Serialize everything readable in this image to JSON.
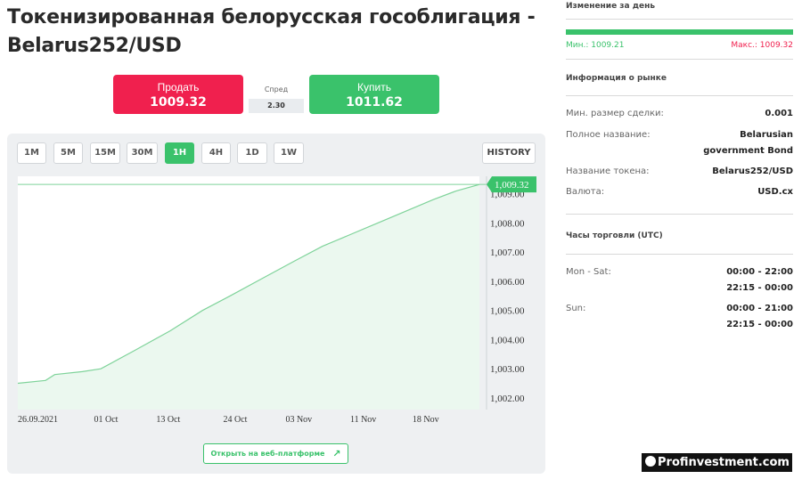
{
  "title": "Токенизированная белорусская гособлигация - Belarus252/USD",
  "trade": {
    "sell_label": "Продать",
    "sell_price": "1009.32",
    "spread_label": "Спред",
    "spread_value": "2.30",
    "buy_label": "Купить",
    "buy_price": "1011.62"
  },
  "timeframes": [
    "1M",
    "5M",
    "15M",
    "30M",
    "1H",
    "4H",
    "1D",
    "1W"
  ],
  "active_timeframe": "1H",
  "history_label": "HISTORY",
  "chart_data": {
    "type": "area",
    "current_price_label": "1,009.32",
    "y_ticks": [
      "1,009.00",
      "1,008.00",
      "1,007.00",
      "1,006.00",
      "1,005.00",
      "1,004.00",
      "1,003.00",
      "1,002.00"
    ],
    "x_ticks": [
      "26.09.2021",
      "01 Oct",
      "13 Oct",
      "24 Oct",
      "03 Nov",
      "11 Nov",
      "18 Nov"
    ],
    "ylim": [
      1001.6,
      1009.6
    ],
    "x": [
      0,
      0.06,
      0.08,
      0.14,
      0.18,
      0.25,
      0.33,
      0.4,
      0.46,
      0.53,
      0.6,
      0.66,
      0.72,
      0.78,
      0.84,
      0.9,
      0.95,
      1.0
    ],
    "values": [
      1002.5,
      1002.6,
      1002.8,
      1002.9,
      1003.0,
      1003.6,
      1004.3,
      1005.0,
      1005.5,
      1006.1,
      1006.7,
      1007.2,
      1007.6,
      1008.0,
      1008.4,
      1008.8,
      1009.1,
      1009.32
    ],
    "colors": {
      "line": "#7fd39a",
      "fill": "#ebf8ef",
      "badge": "#3ac26b"
    }
  },
  "web_platform_label": "Открыть на веб-платформе",
  "day_change": {
    "title": "Изменение за день",
    "min": "Мин.: 1009.21",
    "max": "Макс.: 1009.32",
    "colors": {
      "min": "#3ac26b",
      "max": "#f0204e"
    }
  },
  "market_info": {
    "title": "Информация о рынке",
    "rows": [
      {
        "label": "Мин. размер сделки:",
        "value": "0.001"
      },
      {
        "label": "Полное название:",
        "value": "Belarusian",
        "value2": "government Bond"
      },
      {
        "label": "Название токена:",
        "value": "Belarus252/USD"
      },
      {
        "label": "Валюта:",
        "value": "USD.cx"
      }
    ]
  },
  "trading_hours": {
    "title": "Часы торговли (UTC)",
    "rows": [
      {
        "label": "Mon - Sat:",
        "value": "00:00 - 22:00",
        "value2": "22:15 - 00:00"
      },
      {
        "label": "Sun:",
        "value": "00:00 - 21:00",
        "value2": "22:15 - 00:00"
      }
    ]
  },
  "watermark": "Profinvestment.com"
}
